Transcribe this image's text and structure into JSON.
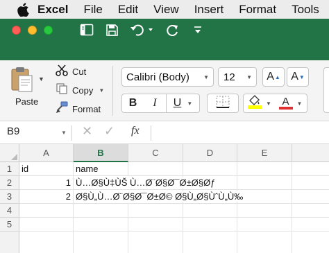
{
  "menubar": {
    "items": [
      "Excel",
      "File",
      "Edit",
      "View",
      "Insert",
      "Format",
      "Tools"
    ]
  },
  "toolbar": {
    "icons": [
      "sidebar-icon",
      "save-icon",
      "undo-icon",
      "redo-icon",
      "customize-icon"
    ]
  },
  "ribbon": {
    "paste_label": "Paste",
    "cut_label": "Cut",
    "copy_label": "Copy",
    "format_label": "Format",
    "font_name": "Calibri (Body)",
    "font_size": "12",
    "grow_label": "A",
    "shrink_label": "A",
    "bold_label": "B",
    "italic_label": "I",
    "underline_label": "U",
    "highlight_color": "#ffff00",
    "font_color": "#e03030",
    "font_color_label": "A"
  },
  "formula_bar": {
    "name_box": "B9",
    "fx_label": "fx",
    "content": ""
  },
  "sheet": {
    "columns": [
      "A",
      "B",
      "C",
      "D",
      "E"
    ],
    "selected_column": "B",
    "rows": [
      {
        "num": "1",
        "a": "id",
        "b": "name"
      },
      {
        "num": "2",
        "a": "1",
        "b": "Ù…Ø§Ù‡ÙŠ Ù…Ø¨Ø§Ø¯Ø±Ø§Øƒ"
      },
      {
        "num": "3",
        "a": "2",
        "b": "Ø§Ù„Ù…Ø¨Ø§Ø¯Ø±Ø© Ø§Ù„Ø§ÙˆÙ„Ù‰"
      },
      {
        "num": "4",
        "a": "",
        "b": ""
      },
      {
        "num": "5",
        "a": "",
        "b": ""
      }
    ]
  }
}
